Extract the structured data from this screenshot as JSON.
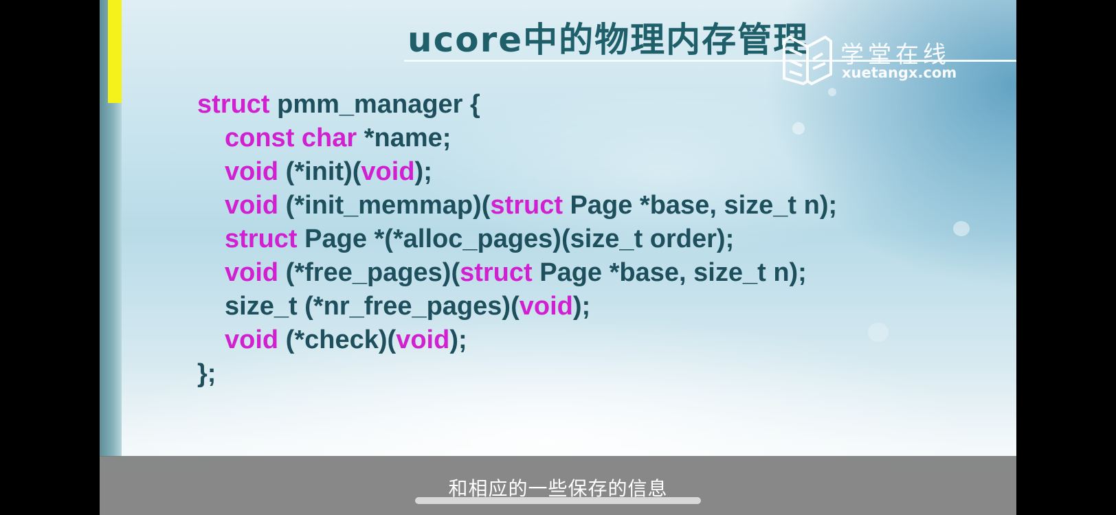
{
  "slide": {
    "title": "ucore中的物理内存管理",
    "logo": {
      "icon": "book-icon",
      "cn_text": "学堂在线",
      "url_text": "xuetangx.com"
    },
    "code_lines": [
      [
        {
          "t": "struct",
          "kw": true
        },
        {
          "t": " pmm_manager {",
          "kw": false
        }
      ],
      [
        {
          "t": "const char",
          "kw": true
        },
        {
          "t": " *name;",
          "kw": false
        }
      ],
      [
        {
          "t": "void",
          "kw": true
        },
        {
          "t": " (*init)(",
          "kw": false
        },
        {
          "t": "void",
          "kw": true
        },
        {
          "t": ");",
          "kw": false
        }
      ],
      [
        {
          "t": "void",
          "kw": true
        },
        {
          "t": " (*init_memmap)(",
          "kw": false
        },
        {
          "t": "struct",
          "kw": true
        },
        {
          "t": " Page *base, size_t n);",
          "kw": false
        }
      ],
      [
        {
          "t": "struct",
          "kw": true
        },
        {
          "t": " Page *(*alloc_pages)(size_t order);",
          "kw": false
        }
      ],
      [
        {
          "t": "void",
          "kw": true
        },
        {
          "t": " (*free_pages)(",
          "kw": false
        },
        {
          "t": "struct",
          "kw": true
        },
        {
          "t": " Page *base, size_t n);",
          "kw": false
        }
      ],
      [
        {
          "t": "size_t (*nr_free_pages)(",
          "kw": false
        },
        {
          "t": "void",
          "kw": true
        },
        {
          "t": ");",
          "kw": false
        }
      ],
      [
        {
          "t": "void",
          "kw": true
        },
        {
          "t": " (*check)(",
          "kw": false
        },
        {
          "t": "void",
          "kw": true
        },
        {
          "t": ");",
          "kw": false
        }
      ],
      [
        {
          "t": "};",
          "kw": false
        }
      ]
    ]
  },
  "player": {
    "subtitle": "和相应的一些保存的信息"
  },
  "colors": {
    "keyword": "#d020d0",
    "code_text": "#1e4f5c",
    "title": "#1f5f6a",
    "accent_bar": "#f4f21a"
  }
}
